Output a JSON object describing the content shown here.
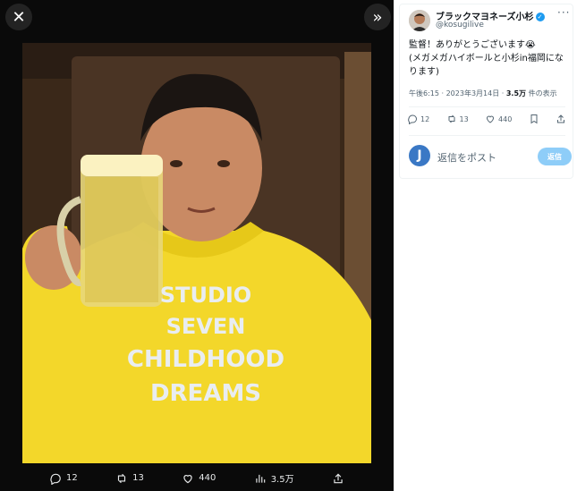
{
  "viewer": {
    "close_label": "✕",
    "expand_label": "»",
    "photo_alt": "",
    "media_actions": {
      "replies": "12",
      "retweets": "13",
      "likes": "440",
      "views": "3.5万"
    }
  },
  "post": {
    "display_name": "ブラックマヨネーズ小杉",
    "handle": "@kosugilive",
    "more_label": "···",
    "text_line1": "監督！ありがとうございます😭",
    "text_line2": "(メガメガハイボールと小杉in福岡になります)",
    "time": "午後6:15 · 2023年3月14日 · ",
    "views_count": "3.5万",
    "views_label": " 件の表示",
    "actions": {
      "replies": "12",
      "retweets": "13",
      "likes": "440"
    }
  },
  "reply": {
    "avatar_letter": "J",
    "placeholder": "返信をポスト",
    "button_label": "返信"
  },
  "hoodie_text": [
    "STUDIO",
    "SEVEN",
    "CHILDHOOD",
    "DREAMS"
  ],
  "colors": {
    "accent": "#1d9bf0",
    "reply_button": "#8ecdf8",
    "hoodie": "#f3d72a"
  }
}
